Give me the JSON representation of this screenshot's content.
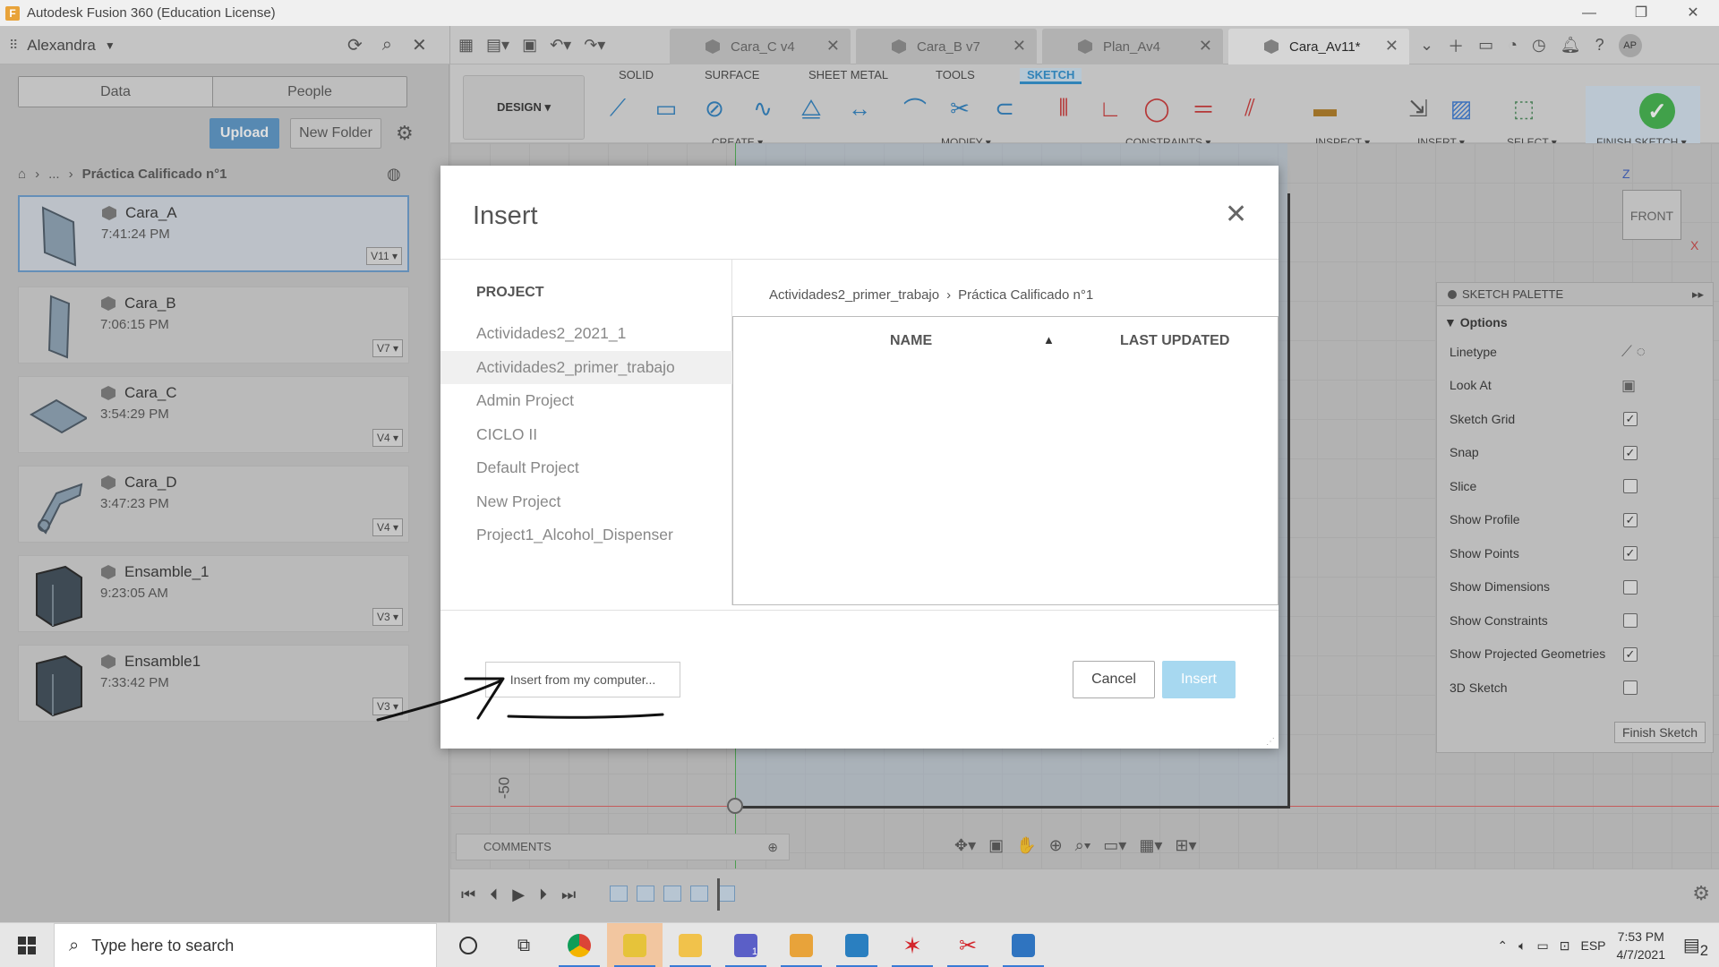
{
  "window": {
    "title": "Autodesk Fusion 360 (Education License)",
    "controls": [
      "—",
      "❐",
      "✕"
    ]
  },
  "user": {
    "name": "Alexandra",
    "initials": "AP"
  },
  "doc_tabs": [
    {
      "label": "Cara_C v4",
      "active": false
    },
    {
      "label": "Cara_B v7",
      "active": false
    },
    {
      "label": "Plan_Av4",
      "active": false
    },
    {
      "label": "Cara_Av11*",
      "active": true
    }
  ],
  "data_panel": {
    "toggle": {
      "data": "Data",
      "people": "People"
    },
    "upload_label": "Upload",
    "new_folder_label": "New Folder",
    "breadcrumb": {
      "ellipsis": "...",
      "current": "Práctica Calificado n°1"
    },
    "files": [
      {
        "name": "Cara_A",
        "time": "7:41:24 PM",
        "version": "V11 ▾"
      },
      {
        "name": "Cara_B",
        "time": "7:06:15 PM",
        "version": "V7 ▾"
      },
      {
        "name": "Cara_C",
        "time": "3:54:29 PM",
        "version": "V4 ▾"
      },
      {
        "name": "Cara_D",
        "time": "3:47:23 PM",
        "version": "V4 ▾"
      },
      {
        "name": "Ensamble_1",
        "time": "9:23:05 AM",
        "version": "V3 ▾"
      },
      {
        "name": "Ensamble1",
        "time": "7:33:42 PM",
        "version": "V3 ▾"
      }
    ]
  },
  "toolbar": {
    "design_label": "DESIGN ▾",
    "tabs": [
      "SOLID",
      "SURFACE",
      "SHEET METAL",
      "TOOLS",
      "SKETCH"
    ],
    "groups": {
      "create": "CREATE ▾",
      "modify": "MODIFY ▾",
      "constraints": "CONSTRAINTS ▾",
      "inspect": "INSPECT ▾",
      "insert": "INSERT ▾",
      "select": "SELECT ▾",
      "finish": "FINISH SKETCH ▾"
    }
  },
  "viewcube": {
    "face": "FRONT",
    "z": "Z",
    "x": "X"
  },
  "canvas": {
    "axis_value": "-50"
  },
  "sketch_palette": {
    "title": "SKETCH PALETTE",
    "options_title": "▼ Options",
    "rows": [
      {
        "label": "Linetype",
        "kind": "icon"
      },
      {
        "label": "Look At",
        "kind": "icon"
      },
      {
        "label": "Sketch Grid",
        "checked": true
      },
      {
        "label": "Snap",
        "checked": true
      },
      {
        "label": "Slice",
        "checked": false
      },
      {
        "label": "Show Profile",
        "checked": true
      },
      {
        "label": "Show Points",
        "checked": true
      },
      {
        "label": "Show Dimensions",
        "checked": false
      },
      {
        "label": "Show Constraints",
        "checked": false
      },
      {
        "label": "Show Projected Geometries",
        "checked": true
      },
      {
        "label": "3D Sketch",
        "checked": false
      }
    ],
    "finish_label": "Finish Sketch"
  },
  "comments": {
    "label": "COMMENTS"
  },
  "modal": {
    "title": "Insert",
    "project_heading": "PROJECT",
    "projects": [
      {
        "name": "Actividades2_2021_1",
        "selected": false
      },
      {
        "name": "Actividades2_primer_trabajo",
        "selected": true
      },
      {
        "name": "Admin Project",
        "selected": false
      },
      {
        "name": "CICLO II",
        "selected": false
      },
      {
        "name": "Default Project",
        "selected": false
      },
      {
        "name": "New Project",
        "selected": false
      },
      {
        "name": "Project1_Alcohol_Dispenser",
        "selected": false
      }
    ],
    "breadcrumb": {
      "project": "Actividades2_primer_trabajo",
      "sep": "›",
      "folder": "Práctica Calificado n°1"
    },
    "columns": {
      "name": "NAME",
      "sort": "▲",
      "updated": "LAST UPDATED"
    },
    "insert_from_computer": "Insert from my computer...",
    "cancel_label": "Cancel",
    "insert_label": "Insert"
  },
  "taskbar": {
    "search_placeholder": "Type here to search",
    "language": "ESP",
    "time": "7:53 PM",
    "date": "4/7/2021",
    "notifications": "2",
    "teams_badge": "1"
  },
  "colors": {
    "accent": "#2a8fd0",
    "upload": "#5a97c8",
    "finish_green": "#3fb44a",
    "insert_disabled": "#a7d8f0"
  }
}
